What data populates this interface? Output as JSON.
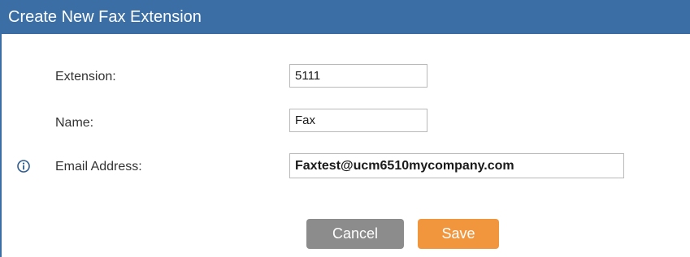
{
  "dialog": {
    "title": "Create New Fax Extension"
  },
  "form": {
    "extension": {
      "label": "Extension:",
      "value": "5111"
    },
    "name": {
      "label": "Name:",
      "value": "Fax"
    },
    "email": {
      "label": "Email Address:",
      "value": "Faxtest@ucm6510mycompany.com",
      "info_icon": "info-circle-icon"
    }
  },
  "buttons": {
    "cancel_label": "Cancel",
    "save_label": "Save"
  },
  "colors": {
    "title_bar": "#3a6ea5",
    "cancel_button": "#8c8c8c",
    "save_button": "#f2963e"
  }
}
